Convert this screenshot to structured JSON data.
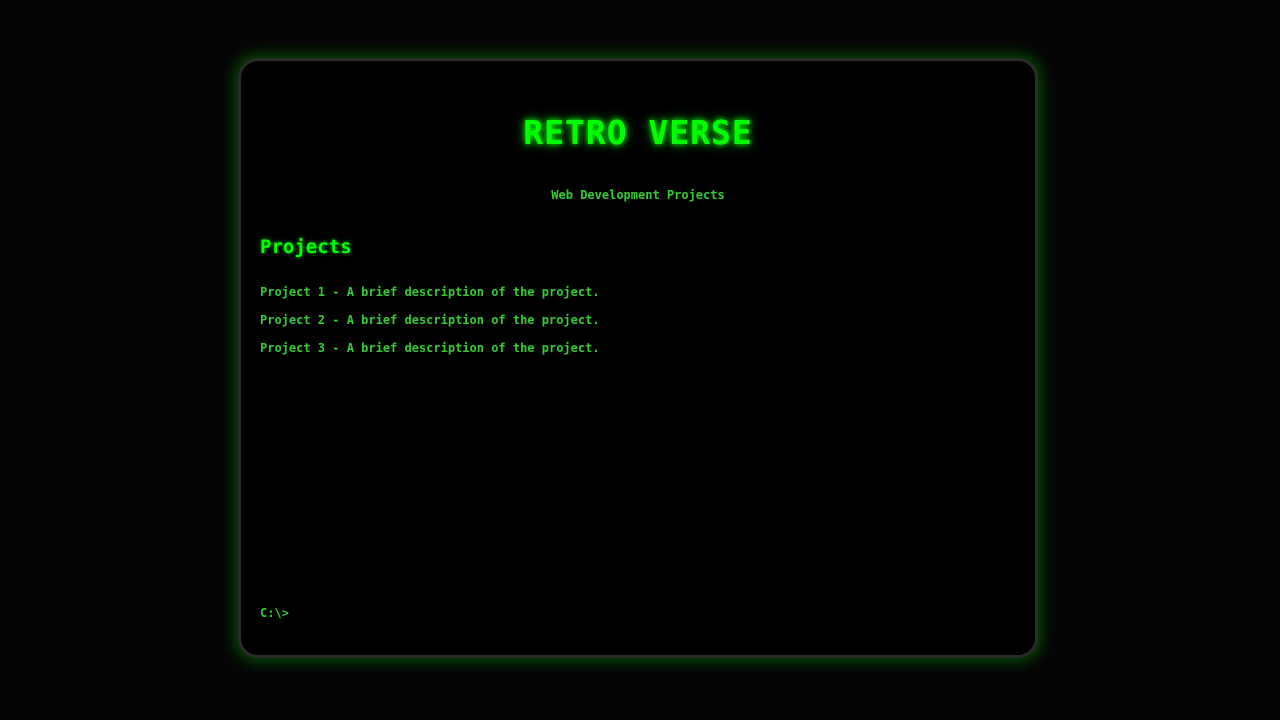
{
  "header": {
    "title": "RETRO VERSE",
    "subtitle": "Web Development Projects"
  },
  "projects": {
    "heading": "Projects",
    "items": [
      "Project 1 - A brief description of the project.",
      "Project 2 - A brief description of the project.",
      "Project 3 - A brief description of the project."
    ]
  },
  "terminal": {
    "prompt": "C:\\>"
  },
  "colors": {
    "accent": "#00ff00",
    "text": "#33cc33",
    "background": "#000000"
  }
}
